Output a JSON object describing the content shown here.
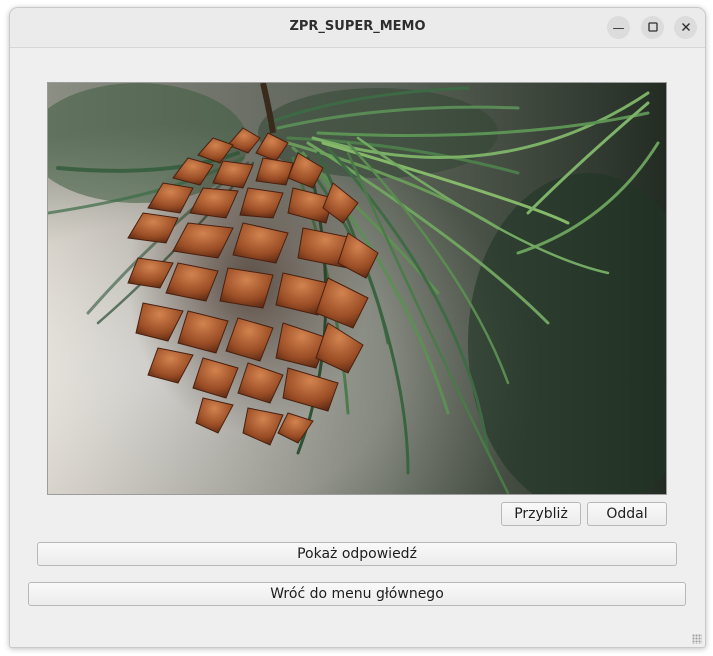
{
  "window": {
    "title": "ZPR_SUPER_MEMO",
    "controls": {
      "minimize_icon": "minimize-icon",
      "maximize_icon": "maximize-icon",
      "close_icon": "close-icon"
    }
  },
  "image": {
    "subject": "pine-cone-photo"
  },
  "zoom": {
    "zoom_in_label": "Przybliż",
    "zoom_out_label": "Oddal"
  },
  "actions": {
    "show_answer_label": "Pokaż odpowiedź",
    "back_to_menu_label": "Wróć do menu głównego"
  },
  "colors": {
    "window_bg": "#efefef",
    "titlebar_bg": "#ebebeb",
    "button_bg": "#f3f3f3"
  }
}
